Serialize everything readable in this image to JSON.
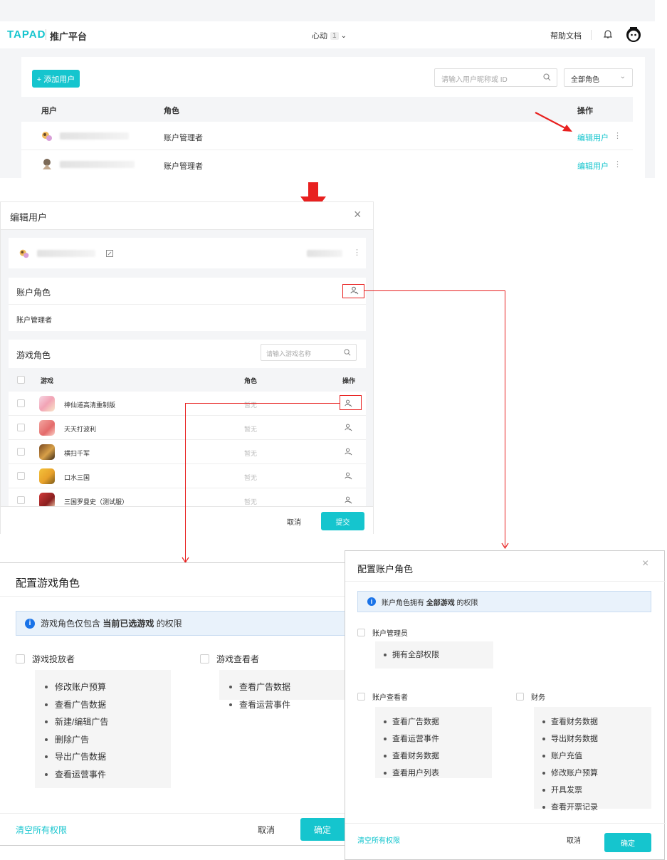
{
  "top": {
    "brand": "TAPAD",
    "brand_sub": "推广平台",
    "account": "心动",
    "account_badge": "1",
    "help": "帮助文档",
    "add_user": "+ 添加用户",
    "search_placeholder": "请输入用户昵称或 ID",
    "role_filter": "全部角色",
    "col_user": "用户",
    "col_role": "角色",
    "col_action": "操作",
    "rows": [
      {
        "role": "账户管理者",
        "action": "编辑用户"
      },
      {
        "role": "账户管理者",
        "action": "编辑用户"
      }
    ]
  },
  "edit": {
    "title": "编辑用户",
    "account_role_title": "账户角色",
    "account_role_value": "账户管理者",
    "game_role_title": "游戏角色",
    "game_search_placeholder": "请输入游戏名称",
    "col_game": "游戏",
    "col_role": "角色",
    "col_action": "操作",
    "games": [
      {
        "name": "神仙道高清重制版",
        "role": "暂无"
      },
      {
        "name": "天天打波利",
        "role": "暂无"
      },
      {
        "name": "横扫千军",
        "role": "暂无"
      },
      {
        "name": "口水三国",
        "role": "暂无"
      },
      {
        "name": "三国罗曼史（测试服）",
        "role": "暂无"
      }
    ],
    "cancel": "取消",
    "submit": "提交"
  },
  "game_role_dialog": {
    "title": "配置游戏角色",
    "info_prefix": "游戏角色仅包含 ",
    "info_bold": "当前已选游戏",
    "info_suffix": " 的权限",
    "role1": "游戏投放者",
    "role1_perms": [
      "修改账户预算",
      "查看广告数据",
      "新建/编辑广告",
      "删除广告",
      "导出广告数据",
      "查看运营事件"
    ],
    "role2": "游戏查看者",
    "role2_perms": [
      "查看广告数据",
      "查看运营事件"
    ],
    "clear": "清空所有权限",
    "cancel": "取消",
    "ok": "确定"
  },
  "account_role_dialog": {
    "title": "配置账户角色",
    "info_prefix": "账户角色拥有 ",
    "info_bold": "全部游戏",
    "info_suffix": " 的权限",
    "admin": "账户管理员",
    "admin_perms": [
      "拥有全部权限"
    ],
    "viewer": "账户查看者",
    "viewer_perms": [
      "查看广告数据",
      "查看运营事件",
      "查看财务数据",
      "查看用户列表"
    ],
    "finance": "财务",
    "finance_perms": [
      "查看财务数据",
      "导出财务数据",
      "账户充值",
      "修改账户预算",
      "开具发票",
      "查看开票记录"
    ],
    "clear": "清空所有权限",
    "cancel": "取消",
    "ok": "确定"
  },
  "colors": {
    "accent": "#15c5ce",
    "arrow": "#e8201f",
    "info_icon": "#1a73e8"
  }
}
